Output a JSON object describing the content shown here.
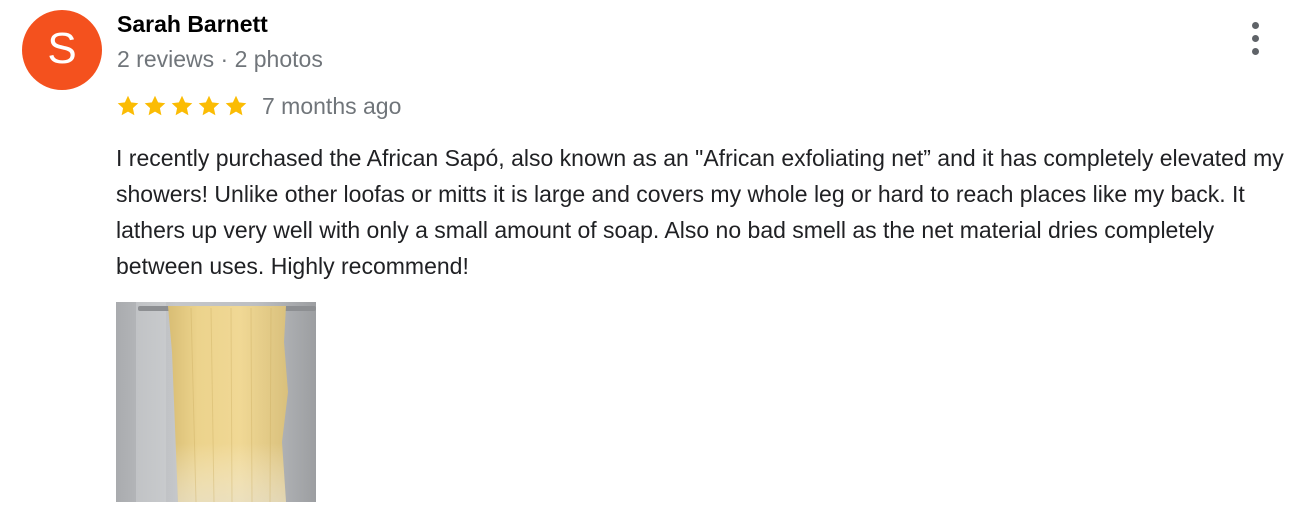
{
  "review": {
    "author": {
      "initial": "S",
      "name": "Sarah Barnett",
      "meta": "2 reviews · 2 photos",
      "avatar_color": "#f4511e"
    },
    "rating": {
      "stars": 5,
      "max_stars": 5,
      "star_color": "#fbbc04",
      "icon": "star-icon"
    },
    "date": "7 months ago",
    "text": "I recently purchased the African Sapó, also known as an \"African exfoliating net” and it has completely elevated my showers! Unlike other loofas or mitts it is large and covers my whole leg or hard to reach places like my back. It lathers up very well with only a small amount of soap. Also no bad smell as the net material dries completely between uses. Highly recommend!",
    "photos": [
      {
        "icon": "photo-thumbnail"
      }
    ],
    "menu_icon": "more-vert-icon"
  }
}
